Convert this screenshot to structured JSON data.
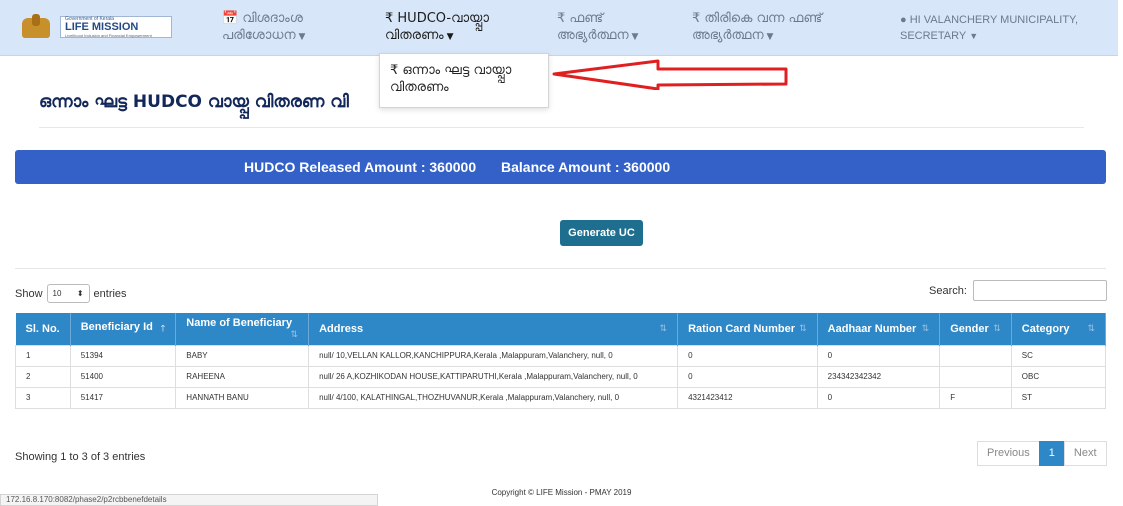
{
  "brand": {
    "gov_text": "Government of Kerala",
    "title": "LIFE MISSION",
    "subtitle": "Livelihood Inclusion and Financial Empowerment"
  },
  "nav": {
    "items": [
      {
        "icon": "calendar-icon",
        "line1": "📅 വിശദാംശ",
        "line2": "പരിശോധന"
      },
      {
        "icon": "rupee-icon",
        "line1": "₹ HUDCO-വായ്പ്പാ",
        "line2": "വിതരണം"
      },
      {
        "icon": "rupee-icon",
        "line1": "₹ ഫണ്ട്",
        "line2": "അഭ്യർത്ഥന"
      },
      {
        "icon": "rupee-icon",
        "line1": "₹ തിരികെ വന്ന ഫണ്ട്",
        "line2": "അഭ്യർത്ഥന"
      }
    ],
    "user_line1": "HI VALANCHERY MUNICIPALITY,",
    "user_line2": "SECRETARY"
  },
  "dropdown": {
    "item_label": "₹ ഒന്നാം ഘട്ട വായ്പ്പാ വിതരണം"
  },
  "page": {
    "title": "ഒന്നാം ഘട്ട HUDCO വായ്പ്പ വിതരണ വി"
  },
  "amounts": {
    "released": "HUDCO Released Amount : 360000",
    "balance": "Balance Amount : 360000"
  },
  "actions": {
    "generate_uc": "Generate UC"
  },
  "table_controls": {
    "show": "Show",
    "length": "10",
    "entries": "entries",
    "search_label": "Search:"
  },
  "table": {
    "headers": [
      "Sl. No.",
      "Beneficiary Id",
      "Name of Beneficiary",
      "Address",
      "Ration Card Number",
      "Aadhaar Number",
      "Gender",
      "Category"
    ],
    "rows": [
      [
        "1",
        "51394",
        "BABY",
        "null/ 10,VELLAN KALLOR,KANCHIPPURA,Kerala ,Malappuram,Valanchery, null, 0",
        "0",
        "0",
        "",
        "SC"
      ],
      [
        "2",
        "51400",
        "RAHEENA",
        "null/ 26 A,KOZHIKODAN HOUSE,KATTIPARUTHI,Kerala ,Malappuram,Valanchery, null, 0",
        "0",
        "234342342342",
        "",
        "OBC"
      ],
      [
        "3",
        "51417",
        "HANNATH BANU",
        "null/ 4/100, KALATHINGAL,THOZHUVANUR,Kerala ,Malappuram,Valanchery, null, 0",
        "4321423412",
        "0",
        "F",
        "ST"
      ]
    ]
  },
  "pagination": {
    "info": "Showing 1 to 3 of 3 entries",
    "previous": "Previous",
    "current": "1",
    "next": "Next"
  },
  "footer": {
    "copyright": "Copyright © LIFE Mission - PMAY 2019",
    "status_url": "172.16.8.170:8082/phase2/p2rcbbenefdetails"
  }
}
